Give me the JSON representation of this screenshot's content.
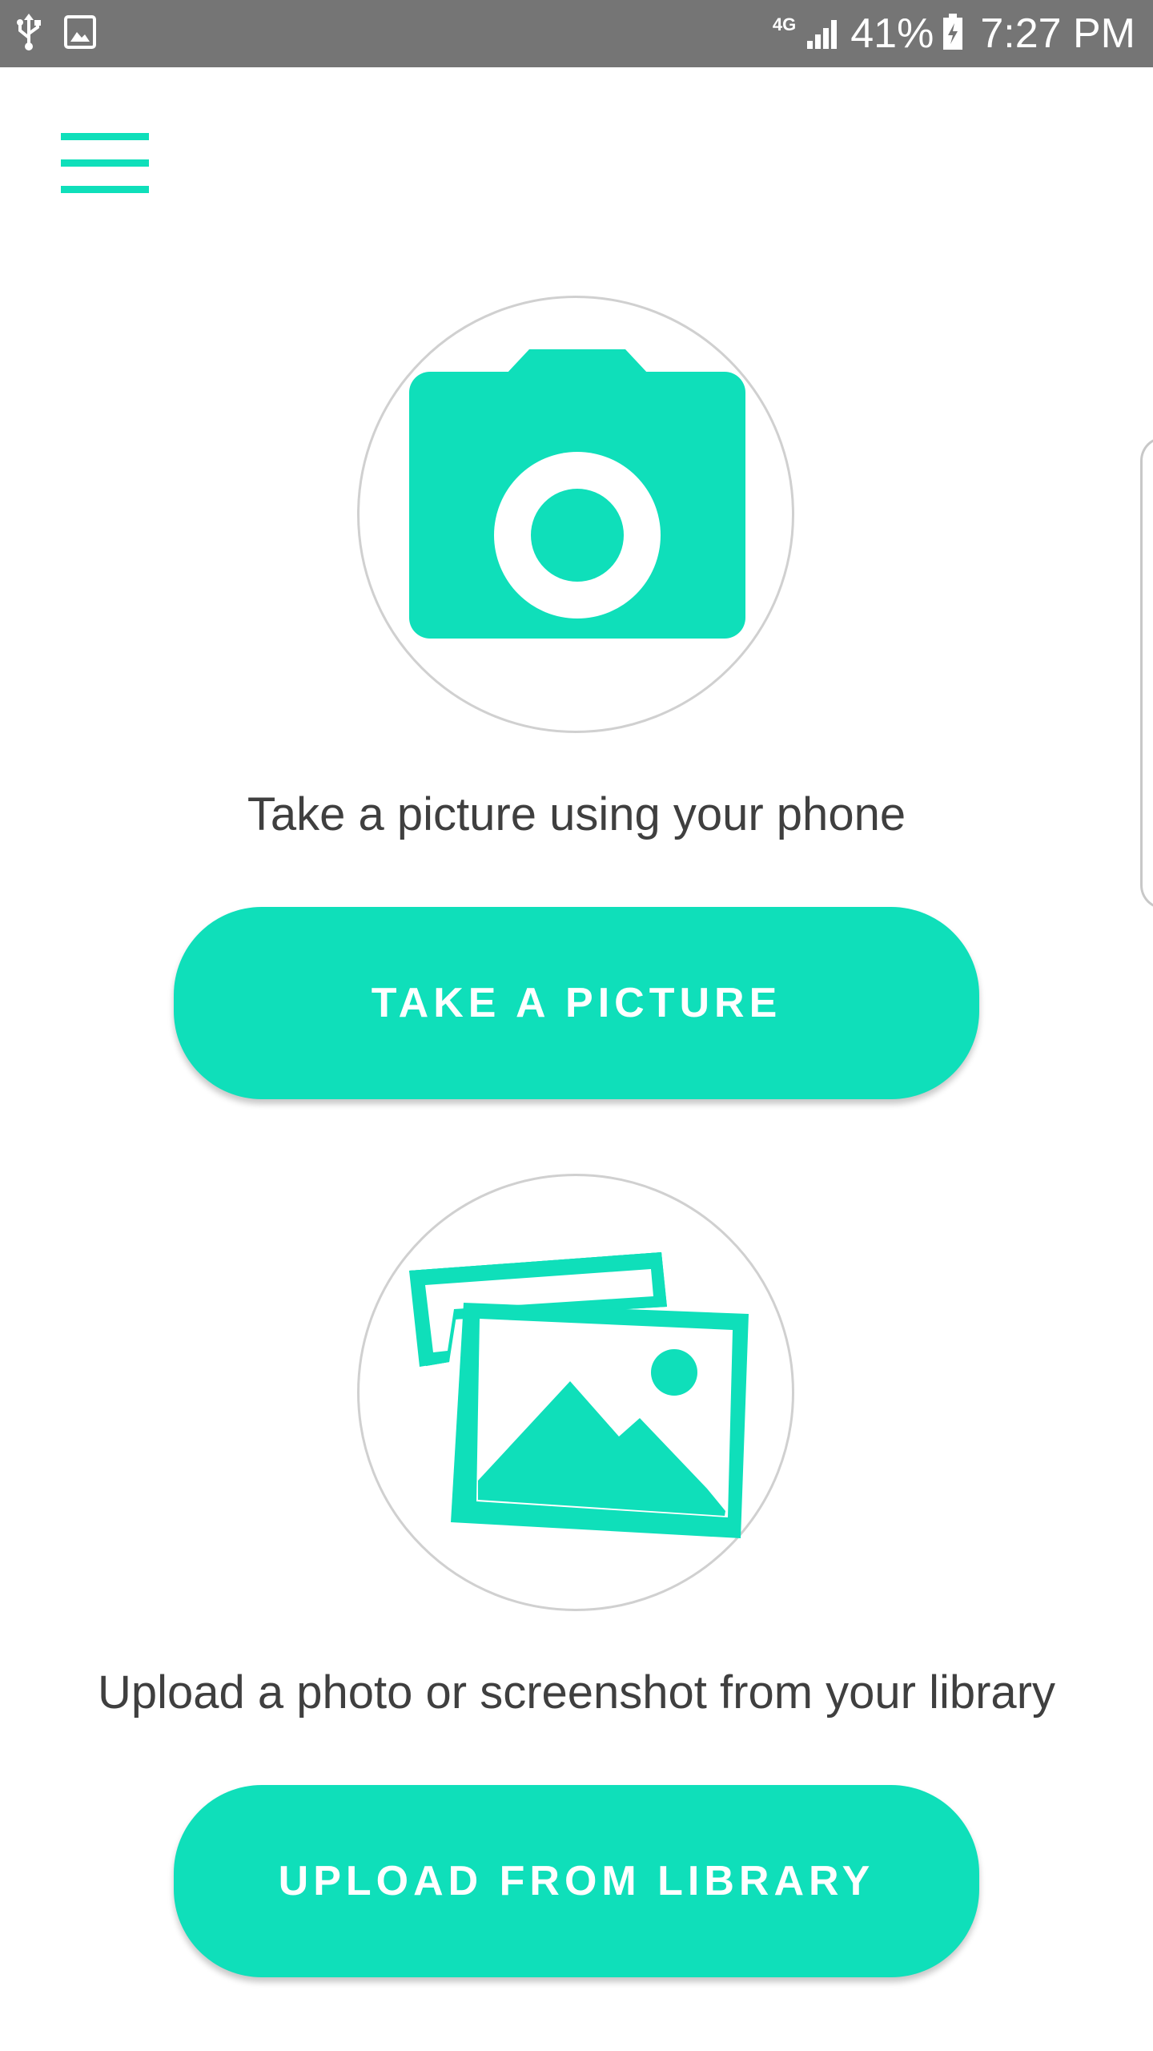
{
  "status_bar": {
    "network": "4G",
    "battery_text": "41%",
    "time": "7:27 PM",
    "icons": [
      "usb-icon",
      "image-notification-icon",
      "signal-icon",
      "battery-charging-icon"
    ]
  },
  "menu": {
    "icon": "hamburger-menu-icon"
  },
  "camera_section": {
    "icon": "camera-icon",
    "caption": "Take a picture using your phone",
    "button_label": "TAKE A PICTURE"
  },
  "library_section": {
    "icon": "photo-library-icon",
    "caption": "Upload a photo or screenshot from your library",
    "button_label": "UPLOAD FROM LIBRARY"
  },
  "colors": {
    "accent": "#0fdfba",
    "status_bar": "#757575",
    "text": "#3f3f3f",
    "circle_border": "#d0d0d0"
  }
}
